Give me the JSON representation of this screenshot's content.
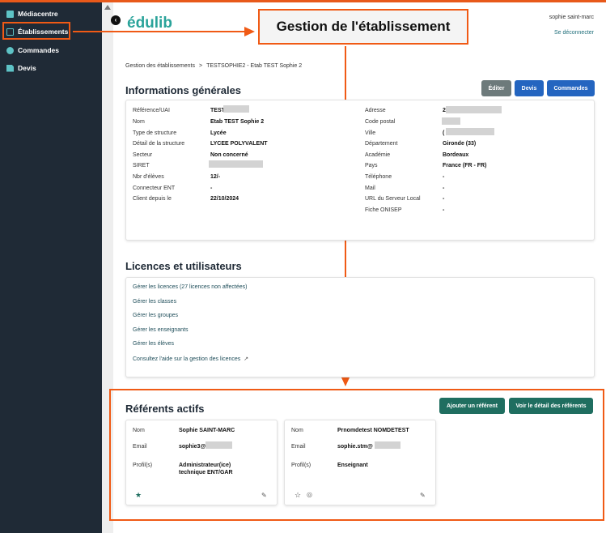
{
  "sidebar": {
    "items": [
      {
        "label": "Médiacentre",
        "icon": "media-icon"
      },
      {
        "label": "Établissements",
        "icon": "building-icon"
      },
      {
        "label": "Commandes",
        "icon": "orders-icon"
      },
      {
        "label": "Devis",
        "icon": "quote-icon"
      }
    ]
  },
  "header": {
    "logo": "édulib",
    "user": "sophie saint-marc",
    "logout": "Se déconnecter"
  },
  "callout": "Gestion de l'établissement",
  "breadcrumb": {
    "root": "Gestion des établissements",
    "separator": ">",
    "current": "TESTSOPHIE2 - Etab TEST Sophie 2"
  },
  "general": {
    "title": "Informations générales",
    "buttons": {
      "edit": "Éditer",
      "quote": "Devis",
      "orders": "Commandes"
    },
    "left": [
      {
        "label": "Référence/UAI",
        "value": "TEST"
      },
      {
        "label": "Nom",
        "value": "Etab TEST Sophie 2"
      },
      {
        "label": "Type de structure",
        "value": "Lycée"
      },
      {
        "label": "Détail de la structure",
        "value": "LYCEE POLYVALENT"
      },
      {
        "label": "Secteur",
        "value": "Non concerné"
      },
      {
        "label": "SIRET",
        "value": ""
      },
      {
        "label": "Nbr d'élèves",
        "value": "12/-"
      },
      {
        "label": "Connecteur ENT",
        "value": "-"
      },
      {
        "label": "Client depuis le",
        "value": "22/10/2024"
      }
    ],
    "right": [
      {
        "label": "Adresse",
        "value": "2"
      },
      {
        "label": "Code postal",
        "value": ""
      },
      {
        "label": "Ville",
        "value": "("
      },
      {
        "label": "Département",
        "value": "Gironde (33)"
      },
      {
        "label": "Académie",
        "value": "Bordeaux"
      },
      {
        "label": "Pays",
        "value": "France (FR - FR)"
      },
      {
        "label": "Téléphone",
        "value": "-"
      },
      {
        "label": "Mail",
        "value": "-"
      },
      {
        "label": "URL du Serveur Local",
        "value": "-"
      },
      {
        "label": "Fiche ONISEP",
        "value": "-"
      }
    ]
  },
  "licences": {
    "title": "Licences et utilisateurs",
    "links": [
      "Gérer les licences (27 licences non affectées)",
      "Gérer les classes",
      "Gérer les groupes",
      "Gérer les enseignants",
      "Gérer les élèves",
      "Consultez l'aide sur la gestion des licences"
    ]
  },
  "referents": {
    "title": "Référents actifs",
    "add_button": "Ajouter un référent",
    "detail_button": "Voir le détail des référents",
    "labels": {
      "name": "Nom",
      "email": "Email",
      "profile": "Profil(s)"
    },
    "cards": [
      {
        "name": "Sophie SAINT-MARC",
        "email": "sophie3@",
        "profile_line1": "Administrateur(ice)",
        "profile_line2": "technique ENT/GAR"
      },
      {
        "name": "Prnomdetest NOMDETEST",
        "email": "sophie.stm@",
        "profile_line1": "Enseignant",
        "profile_line2": ""
      }
    ]
  },
  "colors": {
    "accent": "#f05a15",
    "sidebar": "#1f2a36",
    "teal": "#1f6e60",
    "blue": "#2465c0"
  }
}
